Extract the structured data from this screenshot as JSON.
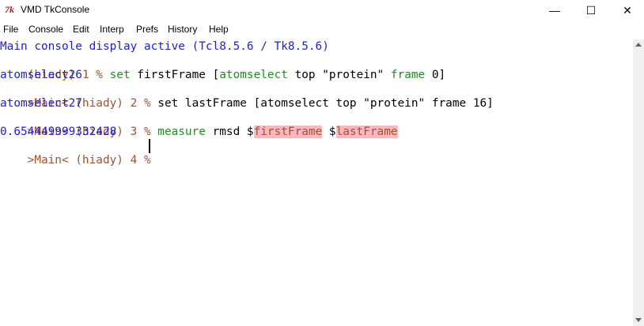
{
  "window": {
    "icon": "tk-feather-icon",
    "icon_glyph": "7k",
    "title": "VMD TkConsole",
    "min_glyph": "—",
    "max_glyph": "☐",
    "close_glyph": "✕"
  },
  "menu": {
    "items": [
      "File",
      "Console",
      "Edit",
      "Interp",
      "Prefs",
      "History",
      "Help"
    ]
  },
  "console": {
    "banner": "Main console display active (Tcl8.5.6 / Tk8.5.6)",
    "line1": {
      "prompt": "(hiady) 1 % ",
      "cmd": "set",
      "arg1": " firstFrame [",
      "sel_cmd": "atomselect",
      "arg2": " top \"protein\" ",
      "frame_kw": "frame",
      "arg3": " 0]"
    },
    "result1": "atomselect26",
    "line2": {
      "prompt": ">Main< (hiady) 2 % ",
      "cmd": "set lastFrame [atomselect top \"protein\" frame 16]"
    },
    "result2": "atomselect27",
    "line3": {
      "prompt": ">Main< (hiady) 3 % ",
      "cmd": "measure",
      "arg1": " rmsd $",
      "var1": "firstFrame",
      "arg2": " $",
      "var2": "lastFrame"
    },
    "result3": "0.654449999332428",
    "line4": {
      "prompt": ">Main< (hiady) 4 % "
    }
  },
  "colors": {
    "output": "#1e1ed2",
    "prompt": "#a0522d",
    "keyword": "#228b22",
    "highlight": "#ffb6c1"
  }
}
